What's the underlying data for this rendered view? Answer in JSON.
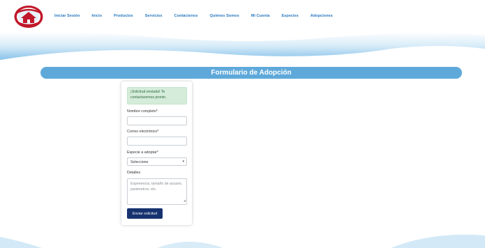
{
  "nav": {
    "items": [
      {
        "label": "Iniciar Sesión"
      },
      {
        "label": "Inicio"
      },
      {
        "label": "Productos"
      },
      {
        "label": "Servicios"
      },
      {
        "label": "Contáctenos"
      },
      {
        "label": "Quiénes Somos"
      },
      {
        "label": "Mi Cuenta"
      },
      {
        "label": "Especies"
      },
      {
        "label": "Adopciones"
      }
    ]
  },
  "colors": {
    "nav_link": "#2a7bc0",
    "banner": "#5fa9da",
    "button": "#16326f",
    "alert_bg": "#d4ecd9",
    "alert_text": "#2f6b3d"
  },
  "page": {
    "title": "Formulario de Adopción"
  },
  "form": {
    "success_message": "¡Solicitud enviada! Te contactaremos pronto.",
    "name_label": "Nombre completo*",
    "name_value": "",
    "email_label": "Correo electrónico*",
    "email_value": "",
    "species_label": "Especie a adoptar*",
    "species_selected": "Seleccione",
    "details_label": "Detalles",
    "details_placeholder": "Experiencia, tamaño de acuario, parámetros, etc.",
    "submit_label": "Enviar solicitud"
  }
}
